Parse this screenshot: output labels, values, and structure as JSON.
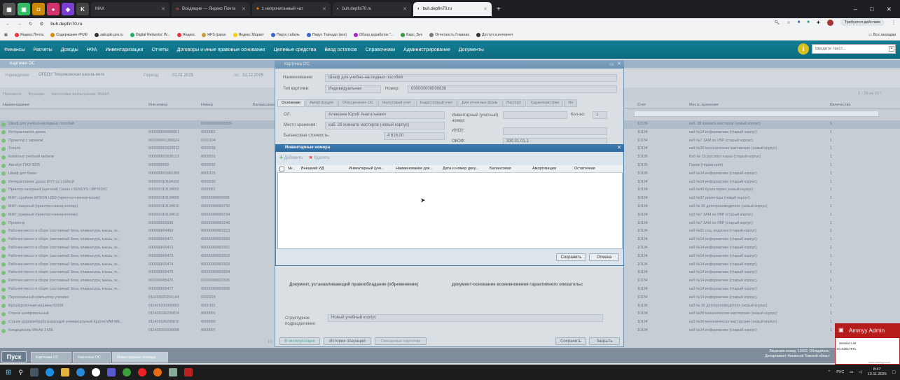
{
  "browser": {
    "tabs": [
      {
        "label": "MAX",
        "active": false
      },
      {
        "label": "Входящие — Яндекс Почта",
        "active": false
      },
      {
        "label": "1 непрочитанный чат",
        "active": false
      },
      {
        "label": "buh.depfin70.ru",
        "active": false
      },
      {
        "label": "buh.depfin70.ru",
        "active": false,
        "active_tab": true
      }
    ],
    "url": "buh.depfin70.ru",
    "action_button": "Требуется действие",
    "bookmarks": [
      "Яндекс.Почта",
      "Содержание /PU8/",
      "zakupki.gov.ru",
      "Digital Networks' W...",
      "Яндекс",
      "HFS /parus",
      "Яндекс Маркет",
      "Парус-табель",
      "Парус Торнадо (все)",
      "Обзор доработок \"...",
      "Барс_Бух",
      "Отчетность Главная",
      "Доступ в интернет"
    ],
    "all_bookmarks": "Все закладки"
  },
  "app": {
    "menu": [
      "Финансы",
      "Расчеты",
      "Доходы",
      "НФА",
      "Инвентаризация",
      "Отчеты",
      "Договоры и иные правовые основания",
      "Целевые средства",
      "Ввод остатков",
      "Справочники",
      "Администрирование",
      "Документы"
    ],
    "search_placeholder": "Введите текст...",
    "bg_window": {
      "title": "Карточки ОС",
      "institution_label": "Учреждение:",
      "institution": "ОГБОУ \"Моряковская школа-инте",
      "period_label": "Период:",
      "period_from": "01.01.2025",
      "period_to_label": "по:",
      "period_to": "31.12.2025",
      "toolbar": [
        "Просмотр",
        "Функции",
        "Настройки фильтрации: ВЫКЛ"
      ],
      "paging": "1 - 26 из 217",
      "columns": [
        "Наименование",
        "Инв.номер",
        "Номер",
        "Балансовая",
        "Счет",
        "Место хранения",
        "Количество"
      ],
      "rows": [
        [
          "Шкаф для учебно-наглядных пособий",
          "",
          "000000000000836",
          "",
          "10136",
          "каб. 28 комната мастеров (новый корпус)",
          "1"
        ],
        [
          "Интерактивная доска",
          "000000000000001",
          "0000081",
          "",
          "10134",
          "каб №14 информатики (старый корпус)",
          "1"
        ],
        [
          "Проектор с экраном",
          "000000001360024",
          "0000104",
          "",
          "10134",
          "каб №7 ЗАМ по УВР (старый корпус)",
          "1"
        ],
        [
          "Точило",
          "000000001620012",
          "0000039",
          "",
          "10134",
          "каб №30 механические мастерские (новый корпус)",
          "1"
        ],
        [
          "Комплект учебной мебели",
          "000000001630112",
          "0000031",
          "",
          "10136",
          "Каб № 15 русского языка (старый корпус)",
          "1"
        ],
        [
          "Автобус ПАЗ-3205",
          "0000000002",
          "0000032",
          "",
          "10135",
          "Гараж (территория)",
          "1"
        ],
        [
          "Шкаф для бумаг",
          "000000001061368",
          "0000125",
          "",
          "10136",
          "каб №14 информатики (старый корпус)",
          "1"
        ],
        [
          "Интерактивная доска 1077 со стойкой",
          "000000110104152",
          "0000230",
          "",
          "10134",
          "каб №14 информатики (старый корпус)",
          "1"
        ],
        [
          "Принтер лазерный (цветной) Canon i-SENSYS LBP7010C",
          "000000110134002",
          "0000081",
          "",
          "10134",
          "каб №40 бухгалтерия (новый корпус)",
          "1"
        ],
        [
          "МФУ струйное EPSON L850 (принтер+сканер+копир)",
          "000000110134005",
          "00000000000591",
          "",
          "10134",
          "каб №37 директора (новый корпус)",
          "1"
        ],
        [
          "МФУ лазерный (принтер+сканер+копир)",
          "000000110134010",
          "00000000000732",
          "",
          "10134",
          "каб № 36 делопроизводителя (новый корпус)",
          "1"
        ],
        [
          "МФУ лазерный (принтер+сканер+копир)",
          "000000110134012",
          "00000000000734",
          "",
          "10134",
          "каб №7 ЗАМ по УВР (старый корпус)",
          "1"
        ],
        [
          "Проектор",
          "000000003936",
          "00000000002246",
          "",
          "10134",
          "каб №7 ЗАМ по УВР (старый корпус)",
          "1"
        ],
        [
          "Рабочее место в сборе (системный блок, клавиатура, мышь, м...",
          "000000004463",
          "00000000002313",
          "",
          "10134",
          "каб №21 соц. педагога (старый корпус)",
          "1"
        ],
        [
          "Рабочее место в сборе (системный блок, клавиатура, мышь, м...",
          "000000005471",
          "00000000002500",
          "",
          "10134",
          "каб №14 информатики (старый корпус)",
          "1"
        ],
        [
          "Рабочее место в сборе (системный блок, клавиатура, мышь, м...",
          "000000005472",
          "00000000002501",
          "",
          "10134",
          "каб №14 информатики (старый корпус)",
          "1"
        ],
        [
          "Рабочее место в сборе (системный блок, клавиатура, мышь, м...",
          "000000005473",
          "00000000002502",
          "",
          "10134",
          "каб №14 информатики (старый корпус)",
          "1"
        ],
        [
          "Рабочее место в сборе (системный блок, клавиатура, мышь, м...",
          "000000005474",
          "00000000002503",
          "",
          "10134",
          "каб №14 информатики (старый корпус)",
          "1"
        ],
        [
          "Рабочее место в сборе (системный блок, клавиатура, мышь, м...",
          "000000005475",
          "00000000002504",
          "",
          "10134",
          "каб №14 информатики (старый корпус)",
          "1"
        ],
        [
          "Рабочее место в сборе (системный блок, клавиатура, мышь, м...",
          "000000005476",
          "00000000002505",
          "",
          "10134",
          "каб №14 информатики (старый корпус)",
          "1"
        ],
        [
          "Рабочее место в сборе (системный блок, клавиатура, мышь, м...",
          "000000005477",
          "00000000002506",
          "",
          "10134",
          "каб №14 информатики (старый корпус)",
          "1"
        ],
        [
          "Персональный компьютер ученика",
          "011143020204144",
          "0000223",
          "",
          "10134",
          "каб №14 информатики (старый корпус)",
          "1"
        ],
        [
          "Брошюровочная машина B2958",
          "011429200000083",
          "0000181",
          "",
          "10136",
          "каб № 36 делопроизводителя (новый корпус)",
          "1"
        ],
        [
          "Станок шлифовальный",
          "011429226220014",
          "0000091",
          "",
          "10134",
          "каб №30 механические мастерские (новый корпус)",
          "1"
        ],
        [
          "Станок деревообрабатывающий универсальный Кратон WM-ME...",
          "011429226290015",
          "0000090",
          "",
          "10134",
          "каб №30 механические мастерские (новый корпус)",
          "1"
        ],
        [
          "Кондиционер WinAir 24ЛЕ",
          "011429253330098",
          "0000097",
          "",
          "10134",
          "каб №14 информатики (старый корпус)",
          "1"
        ]
      ],
      "pager_size": "10",
      "footer_buttons": [
        "Пуск",
        "Карточки ОС",
        "Карточка ОС",
        "Инвентарные номера"
      ],
      "license": "Лицензия номер: 11663; Обладатель:",
      "license_owner": "Департамент Финансов Томской област"
    },
    "card": {
      "title": "Карточка ОС",
      "name_label": "Наименование:",
      "name": "Шкаф для учебно-наглядных пособий",
      "type_label": "Тип карточки:",
      "type": "Индивидуальная",
      "number_label": "Номер:",
      "number": "000000000000836",
      "tabs": [
        "Основная",
        "Амортизация",
        "Обесценение ОС",
        "Налоговый учет",
        "Кадастровый учет",
        "Для отчетных форм",
        "Паспорт",
        "Характеристики",
        "Ин"
      ],
      "ol_label": "ОЛ:",
      "ol": "Алексеев Юрий Анатольевич",
      "storage_label": "Место хранения:",
      "storage": "каб. 28 комната мастеров (новый корпус)",
      "balance_label": "Балансовая стоимость:",
      "balance": "4 616,00",
      "inv_label": "Инвентарный (учетный) номер:",
      "qty_label": "Кол-во:",
      "qty": "1",
      "inou_label": "ИНОУ:",
      "okof_label": "ОКОФ:",
      "okof": "330.31.01.1",
      "doc_ownership": "Документ, устанавливающий правообладание (обременение)",
      "doc_warranty": "Документ-основание возникновения гарантийного обязательс",
      "subdivision_label": "Структурное подразделение:",
      "subdivision": "Новый учебный корпус",
      "bottom_buttons": [
        "В эксплуатации",
        "История операций",
        "Связанные карточки",
        "Сохранить",
        "Закрыть"
      ]
    },
    "modal": {
      "title": "Инвентарные номера",
      "add": "Добавить",
      "delete": "Удалить",
      "columns": [
        "№...",
        "Внешний ИД",
        "Инвентарный (уче...",
        "Наименование док...",
        "Дата и номер доку...",
        "Балансовая",
        "Амортизация",
        "Остаточная"
      ],
      "save": "Сохранить",
      "cancel": "Отмена"
    }
  },
  "ammyy": {
    "title": "Ammyy Admin",
    "line1": "Session List",
    "line2": "ID=53617871",
    "site": "www.ammyy.com"
  },
  "taskbar": {
    "lang": "РУС",
    "time": "8:47",
    "date": "13.11.2025"
  }
}
